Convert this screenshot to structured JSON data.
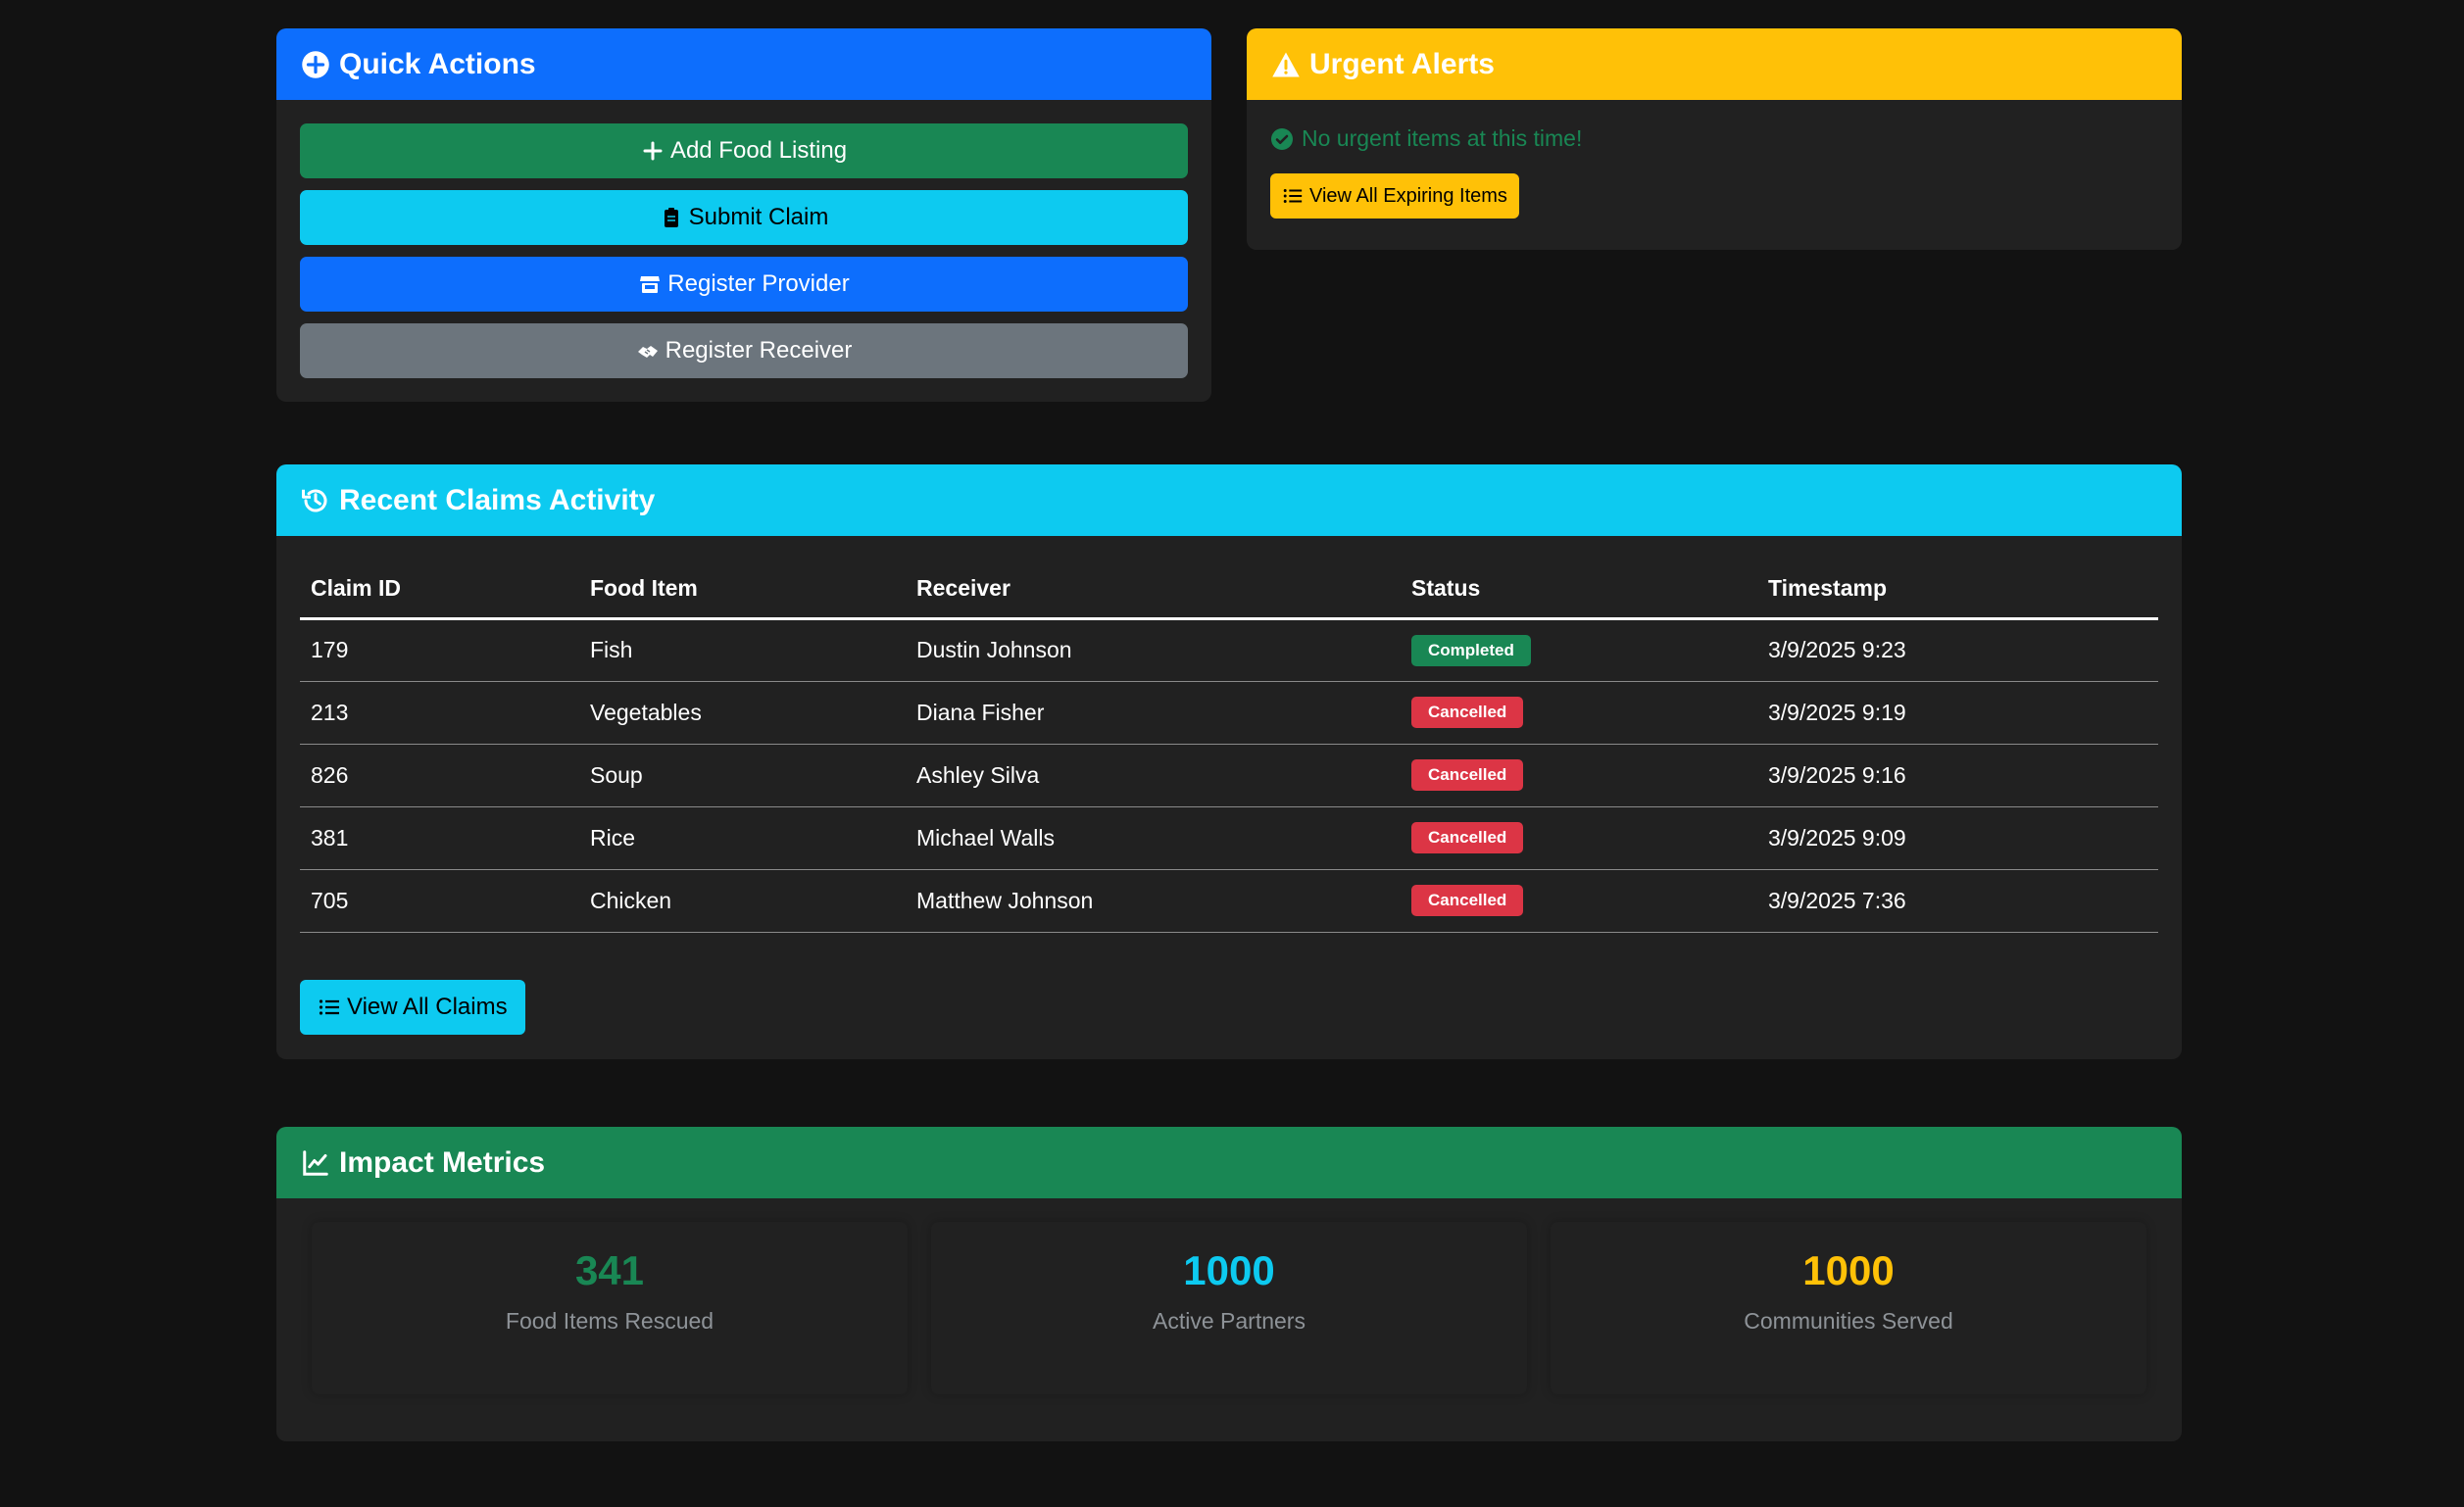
{
  "quick_actions": {
    "title": "Quick Actions",
    "buttons": [
      {
        "label": "Add Food Listing"
      },
      {
        "label": "Submit Claim"
      },
      {
        "label": "Register Provider"
      },
      {
        "label": "Register Receiver"
      }
    ]
  },
  "urgent_alerts": {
    "title": "Urgent Alerts",
    "message": "No urgent items at this time!",
    "view_all_label": "View All Expiring Items"
  },
  "recent_claims": {
    "title": "Recent Claims Activity",
    "columns": [
      "Claim ID",
      "Food Item",
      "Receiver",
      "Status",
      "Timestamp"
    ],
    "rows": [
      {
        "id": "179",
        "food": "Fish",
        "receiver": "Dustin Johnson",
        "status": "Completed",
        "timestamp": "3/9/2025 9:23"
      },
      {
        "id": "213",
        "food": "Vegetables",
        "receiver": "Diana Fisher",
        "status": "Cancelled",
        "timestamp": "3/9/2025 9:19"
      },
      {
        "id": "826",
        "food": "Soup",
        "receiver": "Ashley Silva",
        "status": "Cancelled",
        "timestamp": "3/9/2025 9:16"
      },
      {
        "id": "381",
        "food": "Rice",
        "receiver": "Michael Walls",
        "status": "Cancelled",
        "timestamp": "3/9/2025 9:09"
      },
      {
        "id": "705",
        "food": "Chicken",
        "receiver": "Matthew Johnson",
        "status": "Cancelled",
        "timestamp": "3/9/2025 7:36"
      }
    ],
    "view_all_label": "View All Claims"
  },
  "impact_metrics": {
    "title": "Impact Metrics",
    "metrics": [
      {
        "value": "341",
        "label": "Food Items Rescued",
        "color": "#198754"
      },
      {
        "value": "1000",
        "label": "Active Partners",
        "color": "#0dcaf0"
      },
      {
        "value": "1000",
        "label": "Communities Served",
        "color": "#ffc107"
      }
    ]
  },
  "colors": {
    "primary": "#0d6efd",
    "success": "#198754",
    "info": "#0dcaf0",
    "warning": "#ffc107",
    "danger": "#dc3545",
    "secondary": "#6c757d",
    "background": "#121212",
    "card": "#212121"
  }
}
